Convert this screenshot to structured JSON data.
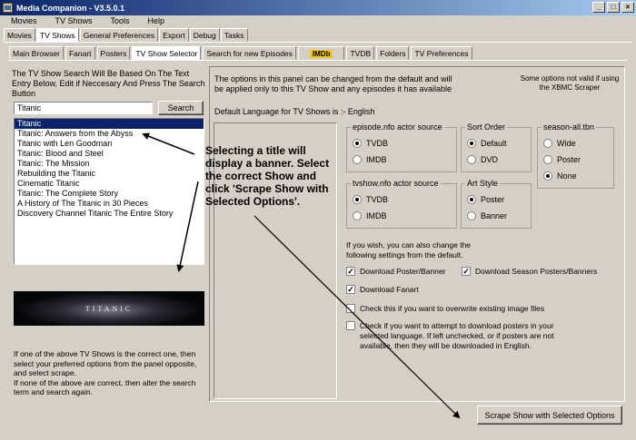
{
  "window": {
    "title": "Media Companion - V3.5.0.1"
  },
  "menu": [
    "Movies",
    "TV Shows",
    "Tools",
    "Help"
  ],
  "main_tabs": [
    "Movies",
    "TV Shows",
    "General Preferences",
    "Export",
    "Debug",
    "Tasks"
  ],
  "sub_tabs": [
    "Main Browser",
    "Fanart",
    "Posters",
    "TV Show Selector",
    "Search for new Episodes",
    "IMDb",
    "TVDB",
    "Folders",
    "TV Preferences"
  ],
  "left": {
    "instructions": "The TV Show Search Will Be Based On The Text Entry Below, Edit if Neccesary And Press The Search Button",
    "search_value": "Titanic",
    "search_button": "Search",
    "results": [
      "Titanic",
      "Titanic: Answers from the Abyss",
      "Titanic with Len Goodman",
      "Titanic: Blood and Steel",
      "Titanic: The Mission",
      "Rebuilding the Titanic",
      "Cinematic Titanic",
      "Titanic: The Complete Story",
      "A History of The Titanic in 30 Pieces",
      "Discovery Channel Titanic The Entire Story"
    ],
    "banner_text": "TITANIC",
    "help_text": "If one of the above TV Shows is the correct one, then select your preferred options from the panel opposite, and select scrape.\nIf none of the above are correct, then alter the search term and search again."
  },
  "right": {
    "options_note": "The options in this panel can be changed from the default and will be applied only to this TV Show and any episodes it has available",
    "xbmc_note": "Some options not valid if using the XBMC Scraper",
    "default_language": "Default Language for TV Shows is :- English",
    "episode_actor_source": {
      "legend": "episode.nfo actor source",
      "options": [
        "TVDB",
        "IMDB"
      ],
      "selected": "TVDB"
    },
    "sort_order": {
      "legend": "Sort Order",
      "options": [
        "Default",
        "DVD"
      ],
      "selected": "Default"
    },
    "season_all": {
      "legend": "season-all.tbn",
      "options": [
        "Wide",
        "Poster",
        "None"
      ],
      "selected": "None"
    },
    "tvshow_actor_source": {
      "legend": "tvshow.nfo actor source",
      "options": [
        "TVDB",
        "IMDB"
      ],
      "selected": "TVDB"
    },
    "art_style": {
      "legend": "Art Style",
      "options": [
        "Poster",
        "Banner"
      ],
      "selected": "Poster"
    },
    "settings_note": "If you wish, you can also change the following settings from the default.",
    "checks": {
      "download_poster": {
        "label": "Download Poster/Banner",
        "checked": true
      },
      "download_season": {
        "label": "Download Season Posters/Banners",
        "checked": true
      },
      "download_fanart": {
        "label": "Download Fanart",
        "checked": true
      },
      "overwrite": {
        "label": "Check this if you want to overwrite existing image files",
        "checked": false
      },
      "language_posters": {
        "label": "Check if you want to attempt to download posters in your selected language. If left unchecked, or if posters are not available, then they will be downloaded in English.",
        "checked": false
      }
    },
    "scrape_button": "Scrape Show with Selected Options"
  },
  "annotation": "Selecting a title will display a banner.  Select the correct Show and click 'Scrape Show with Selected Options'."
}
